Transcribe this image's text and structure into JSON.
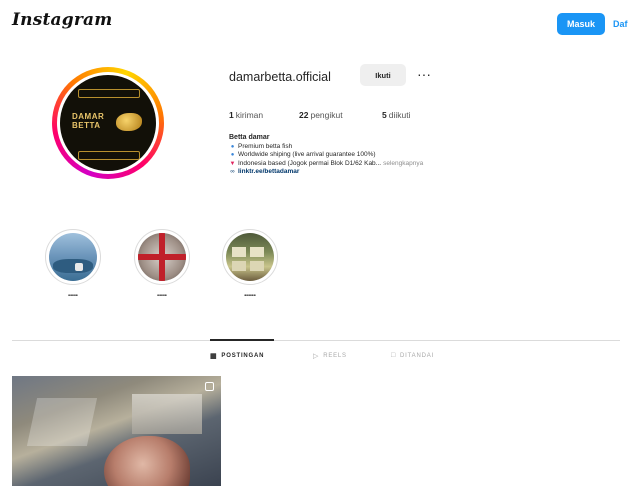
{
  "header": {
    "logo": "Instagram",
    "login_label": "Masuk",
    "signup_label": "Daf"
  },
  "profile": {
    "avatar_brand_line1": "DAMAR",
    "avatar_brand_line2": "BETTA",
    "username": "damarbetta.official",
    "follow_label": "Ikuti",
    "more_label": "···",
    "stats": {
      "posts_count": "1",
      "posts_label": "kiriman",
      "followers_count": "22",
      "followers_label": "pengikut",
      "following_count": "5",
      "following_label": "diikuti"
    },
    "bio": {
      "name": "Betta damar",
      "line1": "Premium betta fish",
      "line2": "Worldwide shiping (live arrival guarantee 100%)",
      "line3": "Indonesia based (Jogok permai Blok D1/62 Kab...",
      "line3_more": "selengkapnya",
      "link": "linktr.ee/bettadamar"
    }
  },
  "highlights": [
    {
      "label": "•••••",
      "theme": "sea"
    },
    {
      "label": "•••••",
      "theme": "flag"
    },
    {
      "label": "••••••",
      "theme": "shop"
    }
  ],
  "tabs": [
    {
      "label": "POSTINGAN",
      "icon": "grid-icon",
      "active": true
    },
    {
      "label": "REELS",
      "icon": "reels-icon",
      "active": false
    },
    {
      "label": "DITANDAI",
      "icon": "tagged-icon",
      "active": false
    }
  ],
  "colors": {
    "accent": "#1a95f5",
    "text": "#262626",
    "link": "#00376b",
    "divider": "#dbdbdb"
  }
}
